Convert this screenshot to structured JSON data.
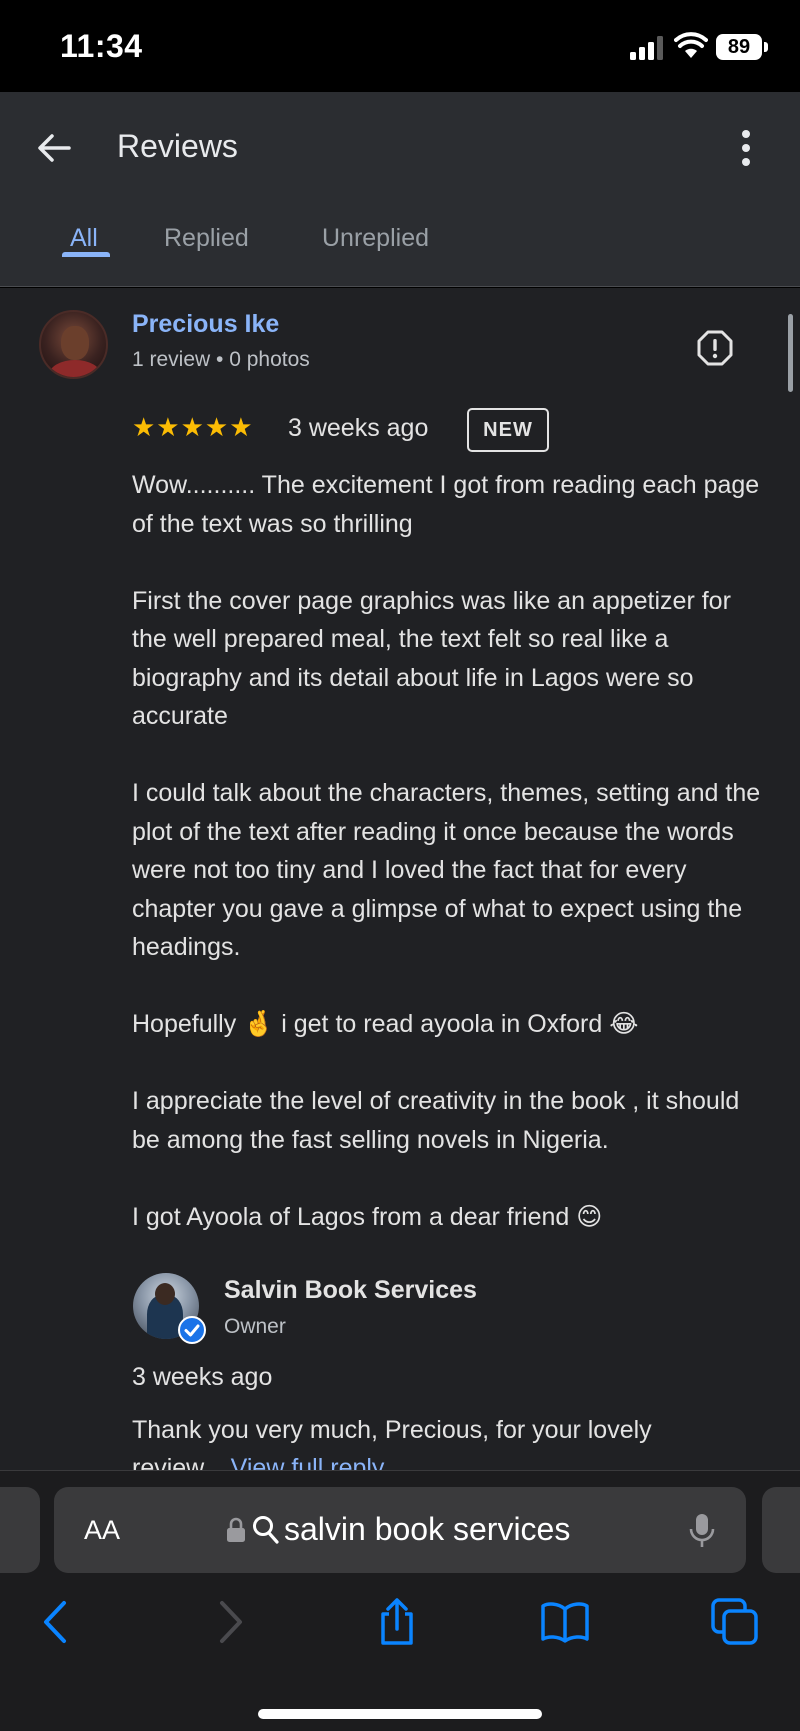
{
  "status_bar": {
    "time": "11:34",
    "battery": "89"
  },
  "appbar": {
    "title": "Reviews",
    "tabs": [
      {
        "label": "All",
        "active": true
      },
      {
        "label": "Replied",
        "active": false
      },
      {
        "label": "Unreplied",
        "active": false
      }
    ]
  },
  "review": {
    "reviewer_name": "Precious Ike",
    "reviewer_meta": "1 review • 0 photos",
    "rating": 5,
    "stars": "★★★★★",
    "time": "3 weeks ago",
    "badge": "NEW",
    "paragraphs": [
      "Wow.......... The excitement I got from reading each page of the text was so thrilling",
      "First the cover page graphics was like an appetizer for the well prepared meal, the text felt so real like a biography and its detail about life in Lagos were so accurate",
      "I could talk about the characters, themes, setting and the plot of the text after reading it once because the words were not too tiny and I loved the fact that for every chapter you gave a glimpse of what to expect using the headings.",
      "Hopefully 🤞 i get to read ayoola in Oxford 😂",
      "I appreciate the level of creativity in the book , it should be among the fast selling novels in Nigeria.",
      "I got Ayoola of Lagos from a dear friend 😊"
    ]
  },
  "reply": {
    "owner_name": "Salvin Book Services",
    "owner_role": "Owner",
    "time": "3 weeks ago",
    "text": "Thank you very much, Precious, for your lovely",
    "text_cont": "review... ",
    "view_full": "View full reply"
  },
  "browser": {
    "aa_label": "AA",
    "url": "salvin book services"
  },
  "colors": {
    "accent": "#8ab4f8",
    "star": "#fbbc04",
    "ios_blue": "#0a84ff"
  },
  "icons": [
    "back-arrow-icon",
    "more-vert-icon",
    "report-icon",
    "verified-icon",
    "lock-icon",
    "search-icon",
    "mic-icon",
    "chevron-left-icon",
    "chevron-right-icon",
    "share-icon",
    "bookmarks-icon",
    "tabs-icon"
  ]
}
